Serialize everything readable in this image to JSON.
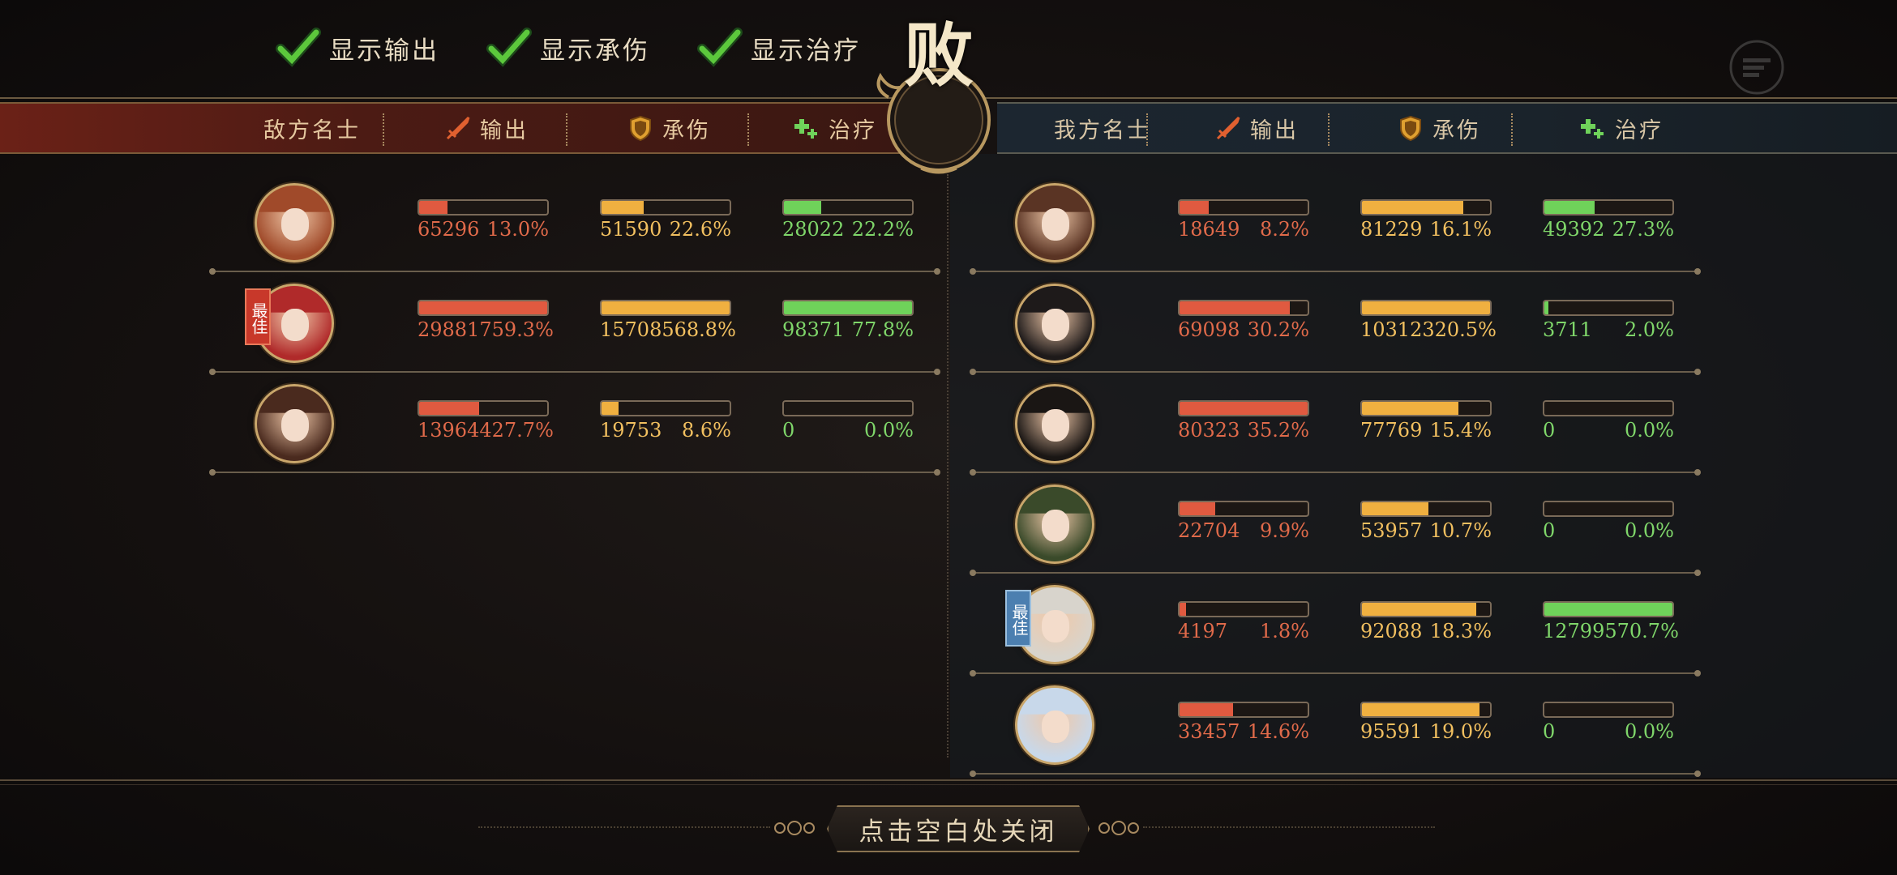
{
  "toggles": [
    {
      "label": "显示输出",
      "checked": true
    },
    {
      "label": "显示承伤",
      "checked": true
    },
    {
      "label": "显示治疗",
      "checked": true
    }
  ],
  "result": {
    "text": "败"
  },
  "enemy_header": {
    "name_col": "敌方名士",
    "output": "输出",
    "damage_taken": "承伤",
    "healing": "治疗"
  },
  "ally_header": {
    "name_col": "我方名士",
    "output": "输出",
    "damage_taken": "承伤",
    "healing": "治疗"
  },
  "colors": {
    "output": "#e05a40",
    "damage_taken": "#f0b040",
    "healing": "#6fd25a"
  },
  "enemy": [
    {
      "best": false,
      "output": {
        "value": "65296",
        "pct": "13.0%",
        "fill": 0.22
      },
      "taken": {
        "value": "51590",
        "pct": "22.6%",
        "fill": 0.33
      },
      "heal": {
        "value": "28022",
        "pct": "22.2%",
        "fill": 0.29
      }
    },
    {
      "best": true,
      "best_label": "最佳",
      "output": {
        "value": "298817",
        "pct": "59.3%",
        "fill": 1.0
      },
      "taken": {
        "value": "157085",
        "pct": "68.8%",
        "fill": 1.0
      },
      "heal": {
        "value": "98371",
        "pct": "77.8%",
        "fill": 1.0
      }
    },
    {
      "best": false,
      "output": {
        "value": "139644",
        "pct": "27.7%",
        "fill": 0.47
      },
      "taken": {
        "value": "19753",
        "pct": "8.6%",
        "fill": 0.13
      },
      "heal": {
        "value": "0",
        "pct": "0.0%",
        "fill": 0.0
      }
    }
  ],
  "ally": [
    {
      "best": false,
      "output": {
        "value": "18649",
        "pct": "8.2%",
        "fill": 0.23
      },
      "taken": {
        "value": "81229",
        "pct": "16.1%",
        "fill": 0.79
      },
      "heal": {
        "value": "49392",
        "pct": "27.3%",
        "fill": 0.39
      }
    },
    {
      "best": false,
      "output": {
        "value": "69098",
        "pct": "30.2%",
        "fill": 0.86
      },
      "taken": {
        "value": "103123",
        "pct": "20.5%",
        "fill": 1.0
      },
      "heal": {
        "value": "3711",
        "pct": "2.0%",
        "fill": 0.03
      }
    },
    {
      "best": false,
      "output": {
        "value": "80323",
        "pct": "35.2%",
        "fill": 1.0
      },
      "taken": {
        "value": "77769",
        "pct": "15.4%",
        "fill": 0.75
      },
      "heal": {
        "value": "0",
        "pct": "0.0%",
        "fill": 0.0
      }
    },
    {
      "best": false,
      "output": {
        "value": "22704",
        "pct": "9.9%",
        "fill": 0.28
      },
      "taken": {
        "value": "53957",
        "pct": "10.7%",
        "fill": 0.52
      },
      "heal": {
        "value": "0",
        "pct": "0.0%",
        "fill": 0.0
      }
    },
    {
      "best": true,
      "best_label": "最佳",
      "output": {
        "value": "4197",
        "pct": "1.8%",
        "fill": 0.05
      },
      "taken": {
        "value": "92088",
        "pct": "18.3%",
        "fill": 0.89
      },
      "heal": {
        "value": "127995",
        "pct": "70.7%",
        "fill": 1.0
      }
    },
    {
      "best": false,
      "output": {
        "value": "33457",
        "pct": "14.6%",
        "fill": 0.42
      },
      "taken": {
        "value": "95591",
        "pct": "19.0%",
        "fill": 0.92
      },
      "heal": {
        "value": "0",
        "pct": "0.0%",
        "fill": 0.0
      }
    }
  ],
  "close_hint": "点击空白处关闭"
}
